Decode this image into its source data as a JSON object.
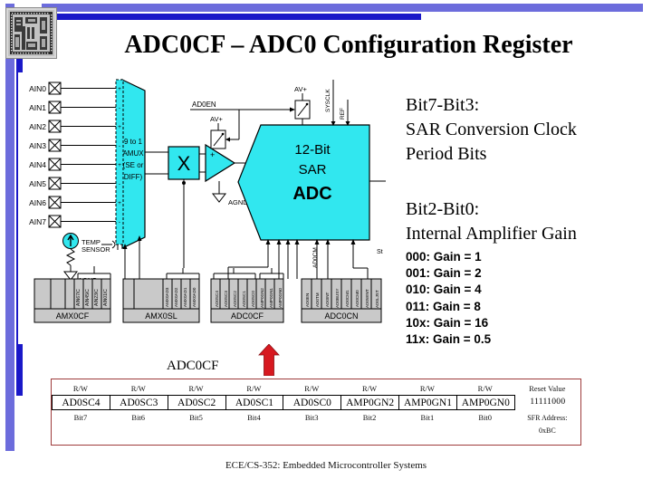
{
  "slide": {
    "title": "ADC0CF – ADC0 Configuration Register",
    "footer": "ECE/CS-352: Embedded Microcontroller Systems",
    "logo_alt": "microcontroller-die-photo",
    "accent_light": "#6c6cdc",
    "accent_dark": "#1a18c8",
    "table_border": "#9e3b3b",
    "arrow_color": "#d71920",
    "block_fill": "#31e7ef"
  },
  "notes": {
    "block1": [
      "Bit7-Bit3:",
      "SAR Conversion Clock",
      "Period Bits"
    ],
    "block2": [
      "Bit2-Bit0:",
      "Internal Amplifier Gain"
    ],
    "gain_list": [
      "000: Gain = 1",
      "001: Gain = 2",
      "010: Gain = 4",
      "011: Gain = 8",
      "10x: Gain = 16",
      "11x: Gain = 0.5"
    ]
  },
  "register": {
    "pointer_label": "ADC0CF",
    "columns": [
      {
        "access": "R/W",
        "name": "AD0SC4",
        "bit": "Bit7"
      },
      {
        "access": "R/W",
        "name": "AD0SC3",
        "bit": "Bit6"
      },
      {
        "access": "R/W",
        "name": "AD0SC2",
        "bit": "Bit5"
      },
      {
        "access": "R/W",
        "name": "AD0SC1",
        "bit": "Bit4"
      },
      {
        "access": "R/W",
        "name": "AD0SC0",
        "bit": "Bit3"
      },
      {
        "access": "R/W",
        "name": "AMP0GN2",
        "bit": "Bit2"
      },
      {
        "access": "R/W",
        "name": "AMP0GN1",
        "bit": "Bit1"
      },
      {
        "access": "R/W",
        "name": "AMP0GN0",
        "bit": "Bit0"
      }
    ],
    "reset": {
      "header": "Reset Value",
      "value": "11111000",
      "sfr_label": "SFR Address:",
      "sfr_address": "0xBC"
    }
  },
  "diagram": {
    "inputs": [
      "AIN0",
      "AIN1",
      "AIN2",
      "AIN3",
      "AIN4",
      "AIN5",
      "AIN6",
      "AIN7"
    ],
    "temp_sensor": [
      "TEMP",
      "SENSOR"
    ],
    "mux_label": [
      "9 to 1",
      "AMUX",
      "(SE or",
      "DIFF)"
    ],
    "gain_block": "X",
    "adc_label": [
      "12-Bit",
      "SAR",
      "ADC"
    ],
    "net_labels": {
      "ad0en": "AD0EN",
      "avplus": "AV+",
      "agnd": "AGND",
      "sysclk": "SYSCLK",
      "vref": "REF",
      "ad0cm": "AD0CM",
      "start": "St"
    },
    "sfr_blocks": [
      {
        "name": "AMX0CF",
        "bits": [
          "AIN67IC",
          "AIN45IC",
          "AIN23IC",
          "AIN01IC"
        ]
      },
      {
        "name": "AMX0SL",
        "bits": [
          "AMX0AD3",
          "AMX0AD2",
          "AMX0AD1",
          "AMX0AD0"
        ]
      },
      {
        "name": "ADC0CF",
        "bits": [
          "AD0SC4",
          "AD0SC3",
          "AD0SC2",
          "AD0SC1",
          "AD0SC0",
          "AMP0GN2",
          "AMP0GN1",
          "AMP0GN0"
        ]
      },
      {
        "name": "ADC0CN",
        "bits": [
          "AD0EN",
          "AD0TM",
          "AD0INT",
          "AD0BUSY",
          "AD0CM1",
          "AD0CM0",
          "AD0WINT",
          "AD0LJST"
        ]
      }
    ]
  }
}
